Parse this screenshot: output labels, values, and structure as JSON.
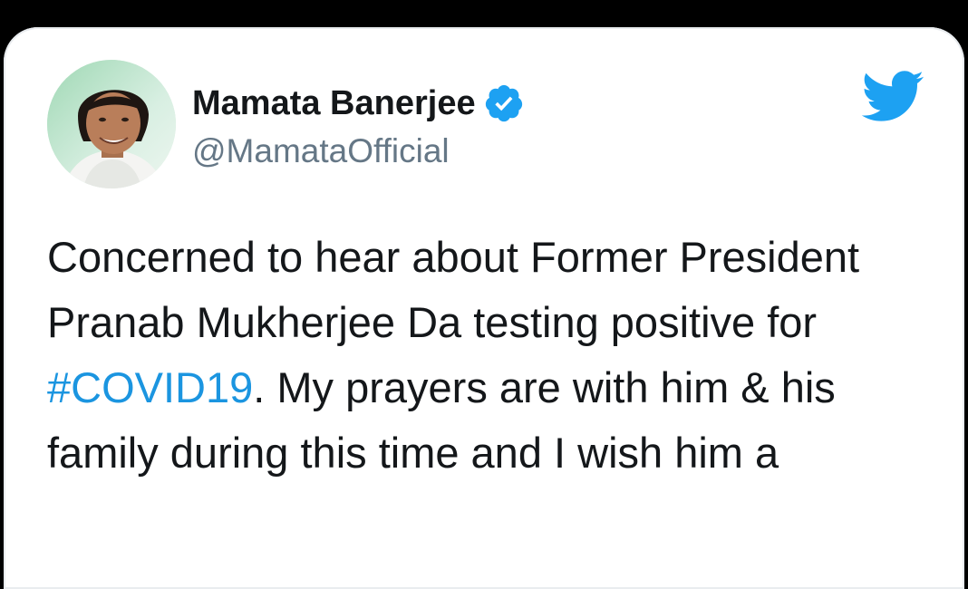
{
  "tweet": {
    "display_name": "Mamata Banerjee",
    "handle": "@MamataOfficial",
    "text_before": "Concerned to hear about Former President Pranab Mukherjee Da testing positive for ",
    "hashtag": "#COVID19",
    "text_after": ". My prayers are with him & his family during this time and I wish him a",
    "accent_color": "#1da1f2",
    "hashtag_color": "#1b95e0"
  },
  "icons": {
    "verified": "verified-badge-icon",
    "brand": "twitter-bird-icon"
  }
}
